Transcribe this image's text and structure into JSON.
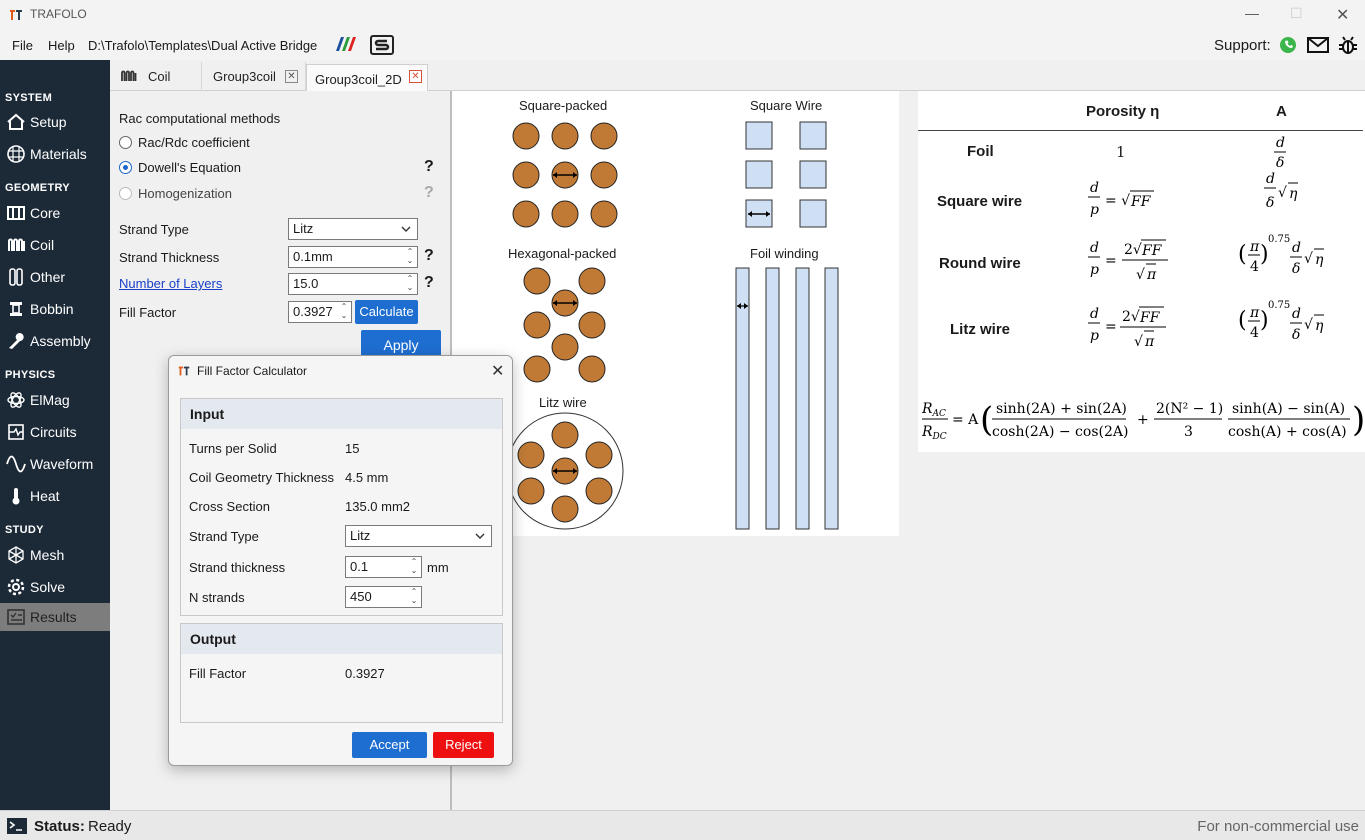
{
  "app": {
    "title": "TRAFOLO"
  },
  "menu": {
    "file": "File",
    "help": "Help",
    "path": "D:\\Trafolo\\Templates\\Dual Active Bridge",
    "support": "Support:"
  },
  "sidebar": {
    "system": "SYSTEM",
    "setup": "Setup",
    "materials": "Materials",
    "geometry": "GEOMETRY",
    "core": "Core",
    "coil": "Coil",
    "other": "Other",
    "bobbin": "Bobbin",
    "assembly": "Assembly",
    "physics": "PHYSICS",
    "elmag": "ElMag",
    "circuits": "Circuits",
    "waveform": "Waveform",
    "heat": "Heat",
    "study": "STUDY",
    "mesh": "Mesh",
    "solve": "Solve",
    "results": "Results"
  },
  "tabs": [
    {
      "label": "Coil"
    },
    {
      "label": "Group3coil"
    },
    {
      "label": "Group3coil_2D"
    }
  ],
  "panel": {
    "rac_title": "Rac computational methods",
    "opt1": "Rac/Rdc coefficient",
    "opt2": "Dowell's Equation",
    "opt3": "Homogenization",
    "strand_type_label": "Strand Type",
    "strand_type_value": "Litz",
    "strand_thickness_label": "Strand Thickness",
    "strand_thickness_value": "0.1mm",
    "layers_label": "Number of Layers",
    "layers_value": "15.0",
    "fill_factor_label": "Fill Factor",
    "fill_factor_value": "0.3927",
    "calculate": "Calculate",
    "apply": "Apply",
    "help": "?"
  },
  "diagram": {
    "square_packed": "Square-packed",
    "square_wire": "Square Wire",
    "hex_packed": "Hexagonal-packed",
    "foil_winding": "Foil winding",
    "litz_wire": "Litz wire"
  },
  "table": {
    "porosity": "Porosity η",
    "a": "A",
    "foil": "Foil",
    "square": "Square wire",
    "round": "Round wire",
    "litz": "Litz wire",
    "foil_porosity": "1"
  },
  "dialog": {
    "title": "Fill Factor Calculator",
    "input": "Input",
    "turns_label": "Turns per Solid",
    "turns_value": "15",
    "thick_label": "Coil Geometry Thickness",
    "thick_value": "4.5 mm",
    "cross_label": "Cross Section",
    "cross_value": "135.0 mm2",
    "stype_label": "Strand Type",
    "stype_value": "Litz",
    "sthick_label": "Strand thickness",
    "sthick_value": "0.1",
    "sthick_unit": "mm",
    "nstrands_label": "N strands",
    "nstrands_value": "450",
    "output": "Output",
    "ff_label": "Fill Factor",
    "ff_value": "0.3927",
    "accept": "Accept",
    "reject": "Reject"
  },
  "status": {
    "label": "Status:",
    "value": "Ready",
    "license": "For non-commercial use"
  }
}
